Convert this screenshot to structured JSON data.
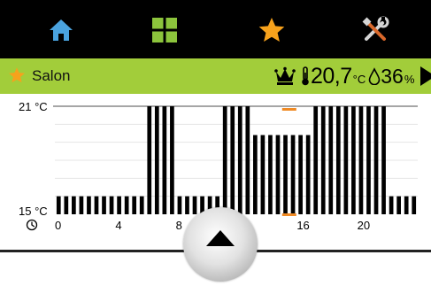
{
  "nav": {
    "items": [
      {
        "name": "home",
        "icon": "home-icon",
        "color": "#4aa3df"
      },
      {
        "name": "grid",
        "icon": "grid-icon",
        "color": "#8cc43c"
      },
      {
        "name": "favorites",
        "icon": "star-icon",
        "color": "#f7a21c"
      },
      {
        "name": "settings",
        "icon": "tools-icon",
        "color": "#d0d0d0"
      }
    ]
  },
  "room": {
    "name": "Salon",
    "temperature": "20,7",
    "temperature_unit": "°C",
    "humidity": "36",
    "humidity_unit": "%",
    "mode_icon": "crown-icon",
    "thermometer_icon": "thermometer-icon",
    "humidity_icon": "drop-icon",
    "next_icon": "play-arrow-icon"
  },
  "chart_data": {
    "type": "bar",
    "title": "",
    "y_max_label": "21 °C",
    "y_min_label": "15 °C",
    "ylim": [
      15,
      21
    ],
    "xlim": [
      0,
      24
    ],
    "x_ticks": [
      "0",
      "4",
      "8",
      "12",
      "16",
      "20"
    ],
    "x_tick_values": [
      0,
      4,
      8,
      12,
      16,
      20
    ],
    "x_label_icon": "clock-icon",
    "current_time_hours": 15.5,
    "current_marker_color": "#f08a24",
    "step_hours": 0.5,
    "segments": [
      {
        "from": 0,
        "to": 6,
        "value": 16
      },
      {
        "from": 6,
        "to": 8,
        "value": 21
      },
      {
        "from": 8,
        "to": 11,
        "value": 16
      },
      {
        "from": 11,
        "to": 13,
        "value": 21
      },
      {
        "from": 13,
        "to": 17,
        "value": 19.4
      },
      {
        "from": 17,
        "to": 22,
        "value": 21
      },
      {
        "from": 22,
        "to": 24,
        "value": 16
      }
    ]
  },
  "scroll_button": {
    "icon": "caret-up-icon"
  }
}
